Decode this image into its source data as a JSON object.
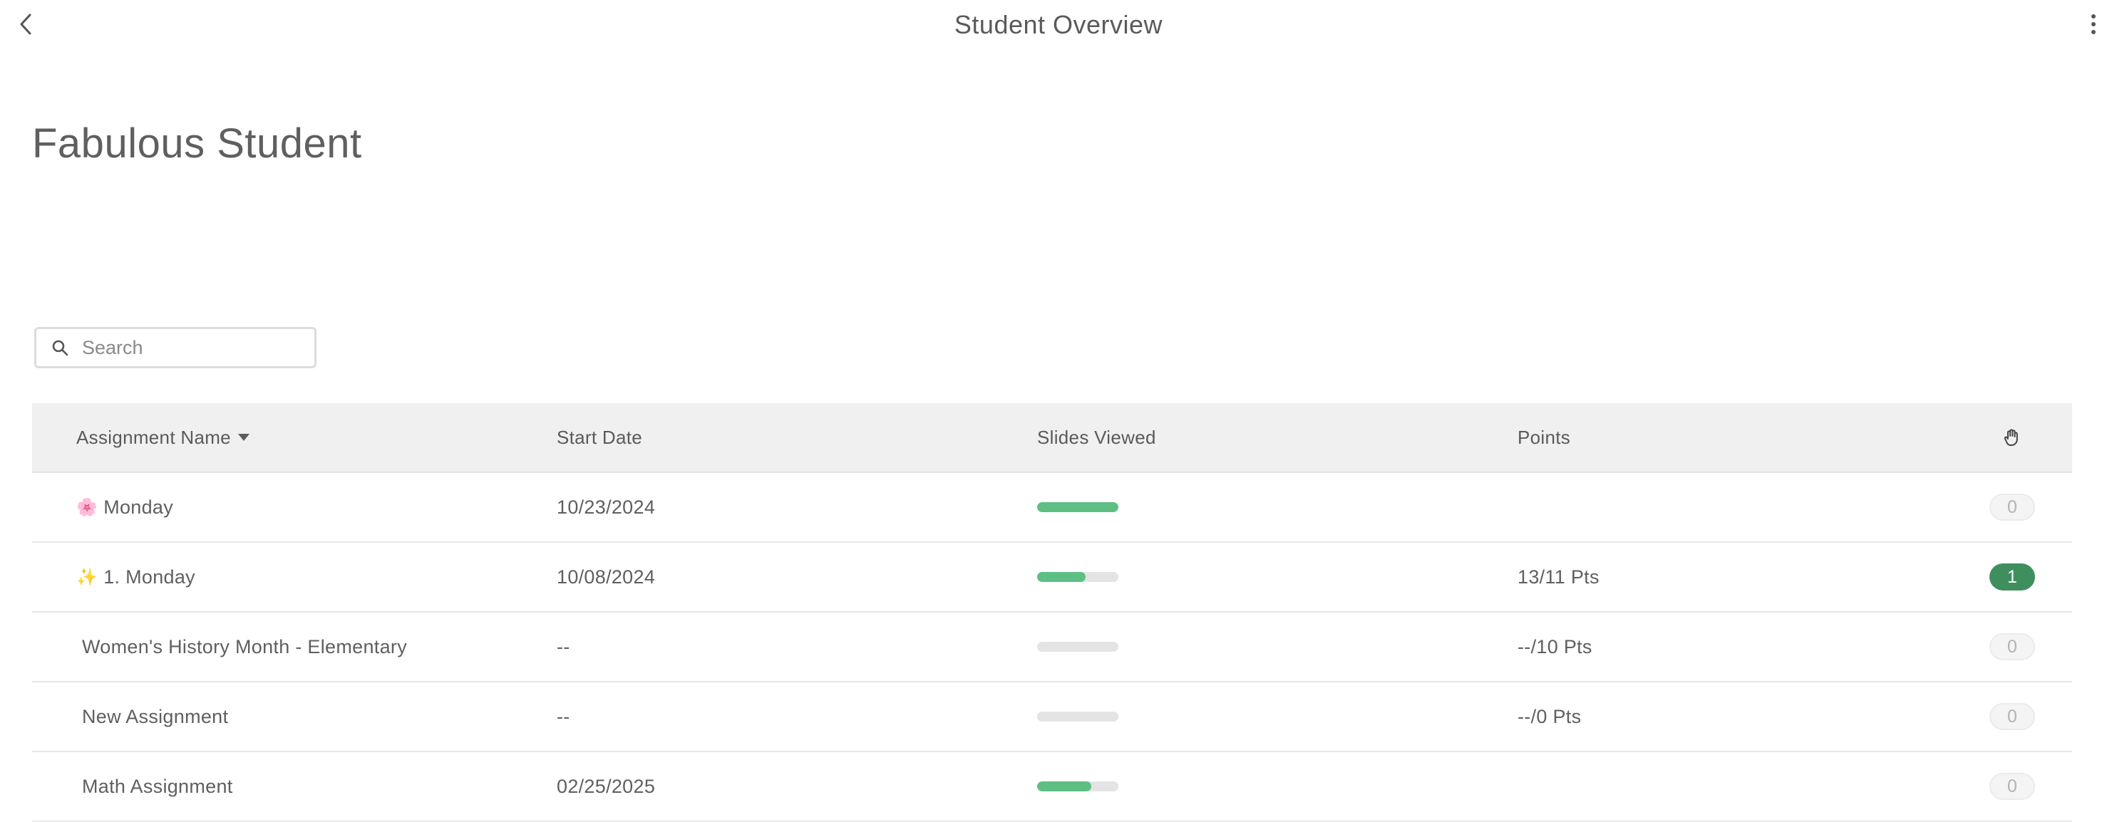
{
  "header": {
    "title": "Student Overview"
  },
  "student": {
    "name": "Fabulous Student"
  },
  "search": {
    "placeholder": "Search",
    "value": ""
  },
  "table": {
    "columns": {
      "name": "Assignment Name",
      "start_date": "Start Date",
      "slides": "Slides Viewed",
      "points": "Points",
      "hand_icon": "raised-hand-icon"
    },
    "rows": [
      {
        "emoji": "🌸",
        "name": "Monday",
        "start_date": "10/23/2024",
        "slides_fraction": 1.0,
        "points": "",
        "count": "0"
      },
      {
        "emoji": "✨",
        "name": "1. Monday",
        "start_date": "10/08/2024",
        "slides_fraction": 0.6,
        "points": "13/11 Pts",
        "count": "1"
      },
      {
        "emoji": "",
        "name": "Women's History Month - Elementary",
        "start_date": "--",
        "slides_fraction": 0.0,
        "points": "--/10 Pts",
        "count": "0"
      },
      {
        "emoji": "",
        "name": "New Assignment",
        "start_date": "--",
        "slides_fraction": 0.0,
        "points": "--/0 Pts",
        "count": "0"
      },
      {
        "emoji": "",
        "name": "Math Assignment",
        "start_date": "02/25/2025",
        "slides_fraction": 0.67,
        "points": "",
        "count": "0"
      }
    ]
  },
  "colors": {
    "bar_fill": "#5dbf84",
    "bar_track": "#e4e4e4",
    "badge_active": "#3f8f5e",
    "header_bg": "#f0f0f0"
  }
}
